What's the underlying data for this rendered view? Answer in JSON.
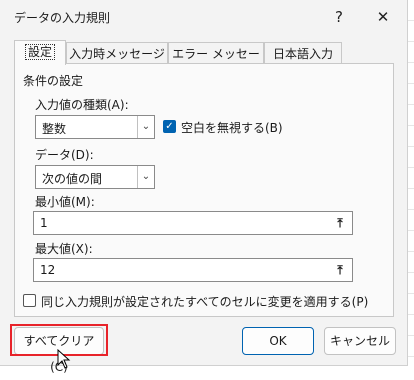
{
  "window": {
    "title": "データの入力規則",
    "help_label": "?",
    "close_label": "✕"
  },
  "tabs": [
    {
      "label": "設定",
      "active": true
    },
    {
      "label": "入力時メッセージ",
      "active": false
    },
    {
      "label": "エラー メッセージ",
      "active": false
    },
    {
      "label": "日本語入力",
      "active": false
    }
  ],
  "settings": {
    "group_title": "条件の設定",
    "allow_label": "入力値の種類(A):",
    "allow_value": "整数",
    "ignore_blank_label": "空白を無視する(B)",
    "ignore_blank_checked": true,
    "data_label": "データ(D):",
    "data_value": "次の値の間",
    "min_label": "最小値(M):",
    "min_value": "1",
    "max_label": "最大値(X):",
    "max_value": "12",
    "apply_all_label": "同じ入力規則が設定されたすべてのセルに変更を適用する(P)",
    "apply_all_checked": false
  },
  "buttons": {
    "clear_all": "すべてクリア(C)",
    "ok": "OK",
    "cancel": "キャンセル"
  },
  "icons": {
    "dropdown": "chevron-down-icon",
    "range": "collapse-range-icon"
  },
  "colors": {
    "highlight": "#e8232a",
    "accent": "#0063b1"
  }
}
